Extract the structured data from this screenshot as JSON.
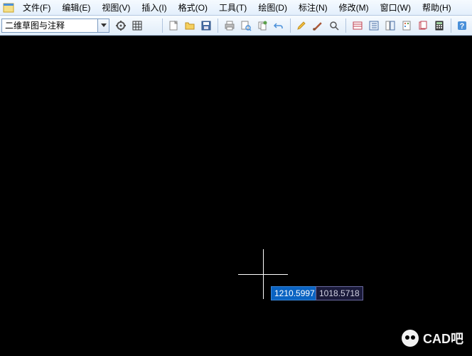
{
  "menubar": {
    "items": [
      {
        "label": "文件(F)"
      },
      {
        "label": "编辑(E)"
      },
      {
        "label": "视图(V)"
      },
      {
        "label": "插入(I)"
      },
      {
        "label": "格式(O)"
      },
      {
        "label": "工具(T)"
      },
      {
        "label": "绘图(D)"
      },
      {
        "label": "标注(N)"
      },
      {
        "label": "修改(M)"
      },
      {
        "label": "窗口(W)"
      },
      {
        "label": "帮助(H)"
      }
    ]
  },
  "toolbar": {
    "workspace_dropdown": "二维草图与注释"
  },
  "canvas": {
    "coord_x": "1210.5997",
    "coord_y": "1018.5718"
  },
  "watermark": {
    "text": "CAD吧"
  }
}
